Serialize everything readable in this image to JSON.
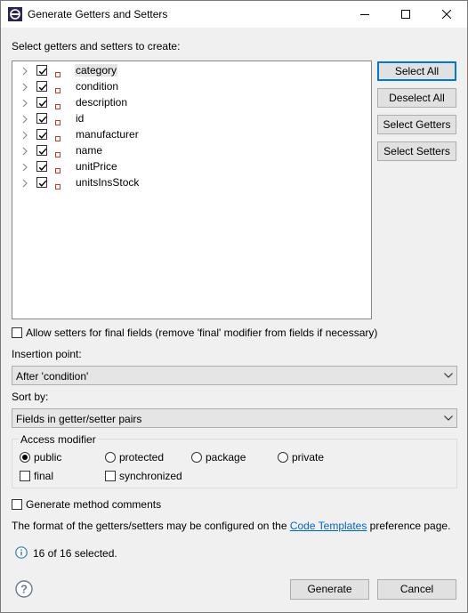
{
  "window": {
    "title": "Generate Getters and Setters"
  },
  "heading": "Select getters and setters to create:",
  "fields": [
    {
      "name": "category",
      "checked": true,
      "selected": true
    },
    {
      "name": "condition",
      "checked": true,
      "selected": false
    },
    {
      "name": "description",
      "checked": true,
      "selected": false
    },
    {
      "name": "id",
      "checked": true,
      "selected": false
    },
    {
      "name": "manufacturer",
      "checked": true,
      "selected": false
    },
    {
      "name": "name",
      "checked": true,
      "selected": false
    },
    {
      "name": "unitPrice",
      "checked": true,
      "selected": false
    },
    {
      "name": "unitsInsStock",
      "checked": true,
      "selected": false
    }
  ],
  "side_buttons": {
    "select_all": "Select All",
    "deselect_all": "Deselect All",
    "select_getters": "Select Getters",
    "select_setters": "Select Setters"
  },
  "allow_setters_final": {
    "label": "Allow setters for final fields (remove 'final' modifier from fields if necessary)",
    "checked": false
  },
  "insertion_point": {
    "label": "Insertion point:",
    "value": "After 'condition'"
  },
  "sort_by": {
    "label": "Sort by:",
    "value": "Fields in getter/setter pairs"
  },
  "access_modifier": {
    "title": "Access modifier",
    "options": [
      "public",
      "protected",
      "package",
      "private"
    ],
    "selected": "public",
    "final_label": "final",
    "final_checked": false,
    "synchronized_label": "synchronized",
    "synchronized_checked": false
  },
  "generate_comments": {
    "label": "Generate method comments",
    "checked": false
  },
  "format_note": {
    "before": "The format of the getters/setters may be configured on the ",
    "link": "Code Templates",
    "after": " preference page."
  },
  "status": "16 of 16 selected.",
  "buttons": {
    "generate": "Generate",
    "cancel": "Cancel"
  },
  "colors": {
    "field_icon": "#c0392b",
    "link": "#0066cc",
    "default_button_border": "#0078d7",
    "info_icon": "#2b7bb9"
  }
}
